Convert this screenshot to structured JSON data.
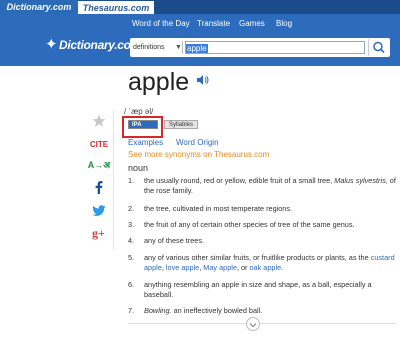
{
  "tabs": {
    "dictionary": "Dictionary.com",
    "thesaurus": "Thesaurus.com"
  },
  "nav": {
    "word_of_day": "Word of the Day",
    "translate": "Translate",
    "games": "Games",
    "blog": "Blog"
  },
  "logo": {
    "text": "Dictionary.com"
  },
  "search": {
    "scope": "definitions",
    "query": "apple"
  },
  "entry": {
    "word": "apple",
    "pronunciation": "/ ˈæp əl/",
    "ipa_label": "IPA",
    "syllables_label": "Syllables",
    "examples_label": "Examples",
    "word_origin_label": "Word Origin",
    "synonyms_link": "See more synonyms on Thesaurus.com",
    "part_of_speech": "noun"
  },
  "share": {
    "cite_label": "CITE",
    "translate_label": "A→अ"
  },
  "definitions": [
    {
      "num": "1.",
      "text": "the usually round, red or yellow, edible fruit of a small tree, ",
      "italic": "Malus sylvestris",
      "tail": ", of the rose family."
    },
    {
      "num": "2.",
      "text": "the tree, cultivated in most temperate regions."
    },
    {
      "num": "3.",
      "text": "the fruit of any of certain other species of tree of the same genus."
    },
    {
      "num": "4.",
      "text": "any of these trees."
    },
    {
      "num": "5.",
      "text": "any of various other similar fruits, or fruitlike products or plants, as the ",
      "links": [
        "custard apple",
        "love apple",
        "May apple",
        "oak apple"
      ]
    },
    {
      "num": "6.",
      "text": "anything resembling an apple in size and shape, as a ball, especially a baseball."
    },
    {
      "num": "7.",
      "italic": "Bowling.",
      "text": " an ineffectively bowled ball."
    }
  ]
}
